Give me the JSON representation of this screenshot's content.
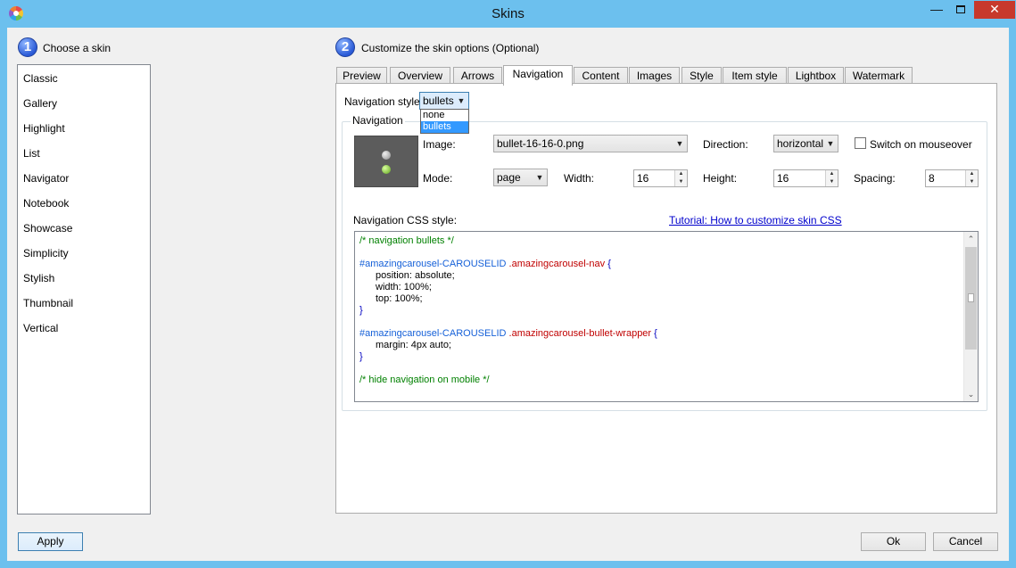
{
  "window": {
    "title": "Skins"
  },
  "step1": {
    "number": "1",
    "title": "Choose a skin"
  },
  "step2": {
    "number": "2",
    "title": "Customize the skin options (Optional)"
  },
  "skins": [
    "Classic",
    "Gallery",
    "Highlight",
    "List",
    "Navigator",
    "Notebook",
    "Showcase",
    "Simplicity",
    "Stylish",
    "Thumbnail",
    "Vertical"
  ],
  "tabs": [
    "Preview",
    "Overview",
    "Arrows",
    "Navigation",
    "Content",
    "Images",
    "Style",
    "Item style",
    "Lightbox",
    "Watermark"
  ],
  "active_tab": "Navigation",
  "nav_style": {
    "label": "Navigation style",
    "value": "bullets",
    "options": [
      "none",
      "bullets"
    ]
  },
  "group": {
    "legend": "Navigation",
    "image_label": "Image:",
    "image_value": "bullet-16-16-0.png",
    "direction_label": "Direction:",
    "direction_value": "horizontal",
    "switch_label": "Switch on mouseover",
    "switch_checked": false,
    "mode_label": "Mode:",
    "mode_value": "page",
    "width_label": "Width:",
    "width_value": "16",
    "height_label": "Height:",
    "height_value": "16",
    "spacing_label": "Spacing:",
    "spacing_value": "8",
    "css_label": "Navigation CSS style:",
    "tutorial_link": "Tutorial: How to customize skin CSS"
  },
  "css_code": {
    "c1": "/* navigation bullets */",
    "id1": "#amazingcarousel-CAROUSELID",
    "class1": ".amazingcarousel-nav",
    "brace_open": "{",
    "p1": "position: absolute;",
    "p2": "width: 100%;",
    "p3": "top: 100%;",
    "brace_close": "}",
    "id2": "#amazingcarousel-CAROUSELID",
    "class2": ".amazingcarousel-bullet-wrapper",
    "p4": "margin: 4px auto;",
    "c2": "/* hide navigation on mobile */"
  },
  "buttons": {
    "apply": "Apply",
    "ok": "Ok",
    "cancel": "Cancel"
  }
}
